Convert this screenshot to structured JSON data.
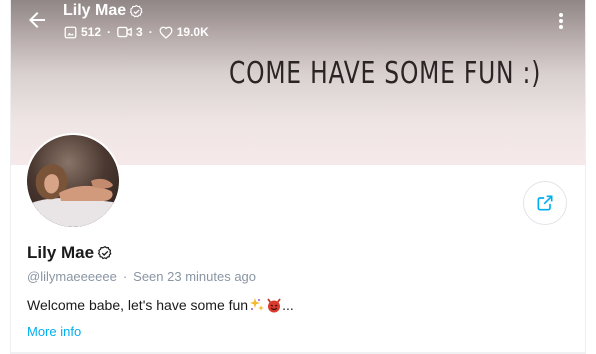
{
  "header": {
    "back_icon": "arrow-left-icon",
    "title": "Lily Mae",
    "stats": {
      "photos": "512",
      "videos": "3",
      "likes": "19.0K"
    },
    "menu_icon": "kebab-menu-icon"
  },
  "cover": {
    "text": "COME HAVE SOME FUN :)"
  },
  "profile": {
    "name": "Lily Mae",
    "handle": "@lilymaeeeeee",
    "separator": "·",
    "last_seen": "Seen 23 minutes ago",
    "bio": "Welcome babe, let's have some fun",
    "bio_suffix": "...",
    "more_info": "More info"
  },
  "colors": {
    "accent": "#00aff0",
    "muted": "#8a96a3",
    "text": "#1a1a1a"
  }
}
